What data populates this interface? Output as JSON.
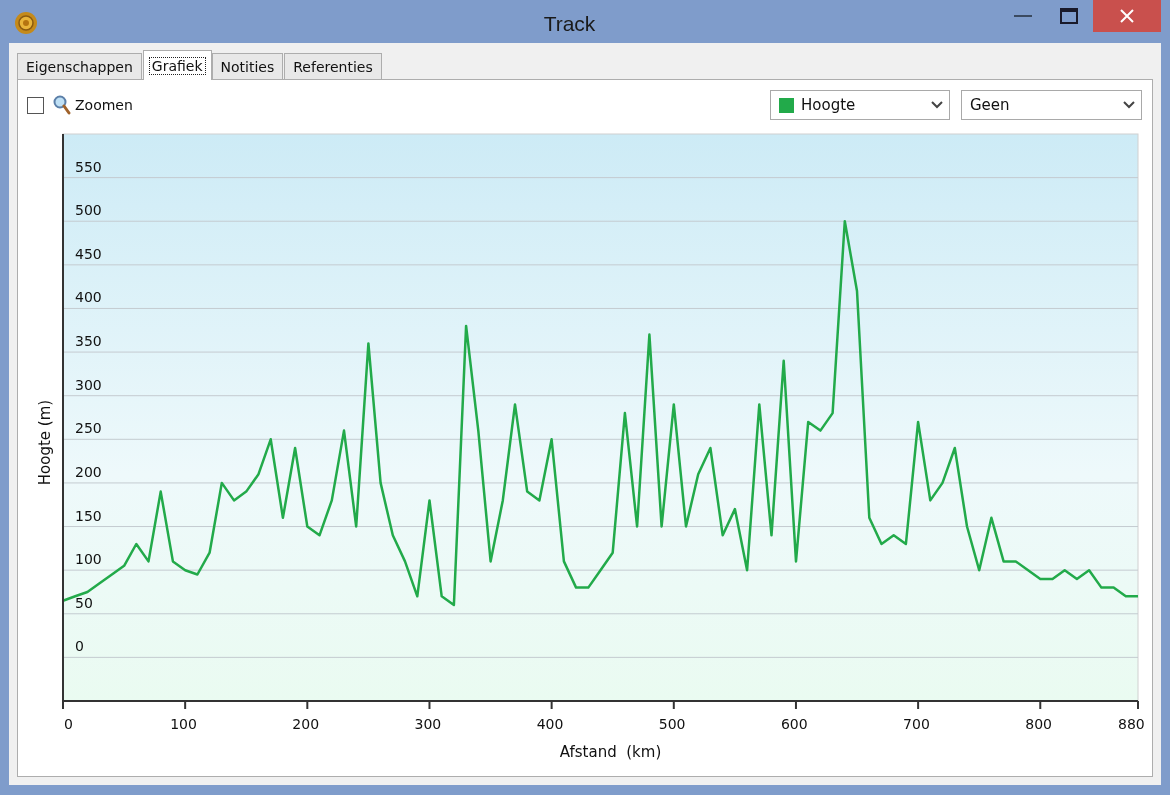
{
  "window": {
    "title": "Track"
  },
  "tabs": [
    {
      "label": "Eigenschappen",
      "selected": false
    },
    {
      "label": "Grafiek",
      "selected": true
    },
    {
      "label": "Notities",
      "selected": false
    },
    {
      "label": "Referenties",
      "selected": false
    }
  ],
  "toolbar": {
    "zoom": {
      "label": "Zoomen",
      "checked": false
    },
    "compare_select": {
      "value": "Geen"
    }
  },
  "chart": {
    "chart_data": {
      "type": "line",
      "xlabel": "Afstand  (km)",
      "ylabel": "Hoogte (m)",
      "x": [
        0,
        10,
        20,
        30,
        40,
        50,
        60,
        70,
        80,
        90,
        100,
        110,
        120,
        130,
        140,
        150,
        160,
        170,
        180,
        190,
        200,
        210,
        220,
        230,
        240,
        250,
        260,
        270,
        280,
        290,
        300,
        310,
        320,
        330,
        340,
        350,
        360,
        370,
        380,
        390,
        400,
        410,
        420,
        430,
        440,
        450,
        460,
        470,
        480,
        490,
        500,
        510,
        520,
        530,
        540,
        550,
        560,
        570,
        580,
        590,
        600,
        610,
        620,
        630,
        640,
        650,
        660,
        670,
        680,
        690,
        700,
        710,
        720,
        730,
        740,
        750,
        760,
        770,
        780,
        790,
        800,
        810,
        820,
        830,
        840,
        850,
        860,
        870,
        880
      ],
      "series": [
        {
          "name": "Hoogte",
          "color": "#22aa4a",
          "values": [
            65,
            70,
            75,
            85,
            95,
            105,
            130,
            110,
            190,
            110,
            100,
            95,
            120,
            200,
            180,
            190,
            210,
            250,
            160,
            240,
            150,
            140,
            180,
            260,
            150,
            360,
            200,
            140,
            110,
            70,
            180,
            70,
            60,
            380,
            260,
            110,
            180,
            290,
            190,
            180,
            250,
            110,
            80,
            80,
            100,
            120,
            280,
            150,
            370,
            150,
            290,
            150,
            210,
            240,
            140,
            170,
            100,
            290,
            140,
            340,
            110,
            270,
            260,
            280,
            500,
            420,
            160,
            130,
            140,
            130,
            270,
            180,
            200,
            240,
            150,
            100,
            160,
            110,
            110,
            100,
            90,
            90,
            100,
            90,
            100,
            80,
            80,
            70,
            70
          ]
        }
      ],
      "xlim": [
        0,
        880
      ],
      "ylim": [
        -50,
        600
      ],
      "xticks": [
        0,
        100,
        200,
        300,
        400,
        500,
        600,
        700,
        800,
        880
      ],
      "yticks": [
        0,
        50,
        100,
        150,
        200,
        250,
        300,
        350,
        400,
        450,
        500,
        550
      ],
      "grid": true
    }
  }
}
